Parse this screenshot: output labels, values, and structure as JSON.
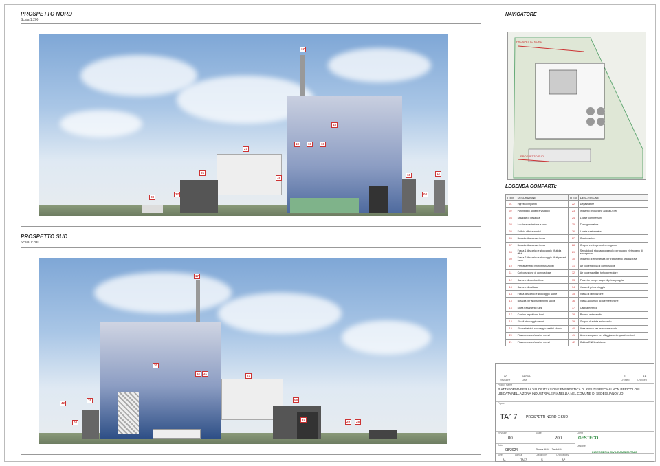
{
  "north": {
    "title": "PROSPETTO NORD",
    "scale": "Scala 1:200"
  },
  "south": {
    "title": "PROSPETTO SUD",
    "scale": "Scala 1:200"
  },
  "north_tags": [
    "17",
    "18",
    "19",
    "19",
    "19",
    "27",
    "05",
    "15",
    "42",
    "19",
    "28",
    "37",
    "04"
  ],
  "south_tags": [
    "17",
    "30",
    "32",
    "31",
    "27",
    "42",
    "15",
    "05",
    "04",
    "37",
    "29",
    "28"
  ],
  "navigator": {
    "title": "NAVIGATORE",
    "label_nord": "PROSPETTO NORD",
    "label_sud": "PROSPETTO SUD"
  },
  "legend": {
    "title": "LEGENDA COMPARTI:",
    "headers": [
      "ITEM",
      "DESCRIZIONE",
      "ITEM",
      "DESCRIZIONE"
    ],
    "rows": [
      [
        "01",
        "Ingresso impianto",
        "22",
        "Degassatore"
      ],
      [
        "02",
        "Parcheggio addetti e visitatori",
        "23",
        "Impianto produzione acqua DEMI"
      ],
      [
        "03",
        "Stazione di pesatura",
        "24",
        "Locale compressori"
      ],
      [
        "04",
        "Locale accettazione e pesa",
        "25",
        "Turbogeneratore"
      ],
      [
        "05",
        "Edificio uffici e servizi",
        "26",
        "Locale trasformatori"
      ],
      [
        "06",
        "Bussola di accesso fossa",
        "27",
        "Condensatore"
      ],
      [
        "07",
        "Bussola di accesso fossa",
        "28",
        "Gruppo elettrogeno di emergenza"
      ],
      [
        "08",
        "Fossa 1 di scarico e stoccaggio rifiuti da rifiuti",
        "29",
        "Serbatoio di stoccaggio gasolio per gruppo elettrogeno di emergenza"
      ],
      [
        "09",
        "Fossa 2 di scarico e stoccaggio rifiuti pesanti forno",
        "30",
        "Impianto di emergenza per trattamento aria aspirata"
      ],
      [
        "10",
        "Pretrattamento rifiuti (triturazione)",
        "31",
        "Air cooler griglia di combustione"
      ],
      [
        "11",
        "Carico sezione di combustione",
        "32",
        "Air cooler ausiliari turbogeneratore"
      ],
      [
        "12",
        "Sezione di combustione",
        "33",
        "Pozzetto pompe acque di prima pioggia"
      ],
      [
        "13",
        "Sezione di caldaia",
        "34",
        "Vasca di prima pioggia"
      ],
      [
        "14",
        "Fossa di scarico e stoccaggio scorie",
        "35",
        "Vasca di laminazione"
      ],
      [
        "15",
        "Bussola per allontanamento scorie",
        "36",
        "Vasca accumulo acque meteoriche"
      ],
      [
        "16",
        "Linea trattamento fumi",
        "37",
        "Cabina elettrica"
      ],
      [
        "17",
        "Camino espulsione fumi",
        "38",
        "Riserva antincendio"
      ],
      [
        "18",
        "Silo di stoccaggio veneri",
        "39",
        "Gruppo di spinta antincendio"
      ],
      [
        "19",
        "Silo/serbatoi di stoccaggio reattivi chimici",
        "40",
        "Area tecnica per estrazione scorie"
      ],
      [
        "20",
        "Piazzole carico/scarico mezzi",
        "41",
        "Area a soppalco per alloggiamento quadri elettrici"
      ],
      [
        "21",
        "Piazzole carico/scarico mezzi",
        "42",
        "Cabina ENEL esistente"
      ]
    ]
  },
  "titleblock": {
    "rev": "00",
    "rev_date": "08/2024",
    "rev_col": "Revisione",
    "date_col": "Data",
    "created": "S",
    "checked": "AP",
    "created_col": "Created",
    "checked_col": "Checked",
    "project_label": "Project Name",
    "project": "PIATTAFORMA PER LA VALORIZZAZIONE ENERGETICA DI RIFIUTI SPECIALI NON PERICOLOSI UBICATA NELLA ZONA INDUSTRIALE PIANELLIA NEL COMUNE DI SEDEGLIANO (UD)",
    "figure_label": "Figure",
    "code": "TA17",
    "figure": "PROSPETTI NORD E SUD",
    "revision_label": "Revision",
    "revision": "00",
    "scale_label": "Scale",
    "scale": "200",
    "client_label": "Client",
    "client": "GESTECO",
    "date_label": "Date",
    "date": "08/2024",
    "phase": "Phase ***** - Task ***",
    "size_label": "Size",
    "size": "A1",
    "layout_label": "Layout",
    "layout": "TA17",
    "createdby_label": "Created by",
    "createdby": "S",
    "checkedby_label": "Checked by",
    "checkedby": "AP",
    "designer_label": "Designer",
    "designer": "INGEGNERIA CIVILE AMBIENTALE"
  }
}
